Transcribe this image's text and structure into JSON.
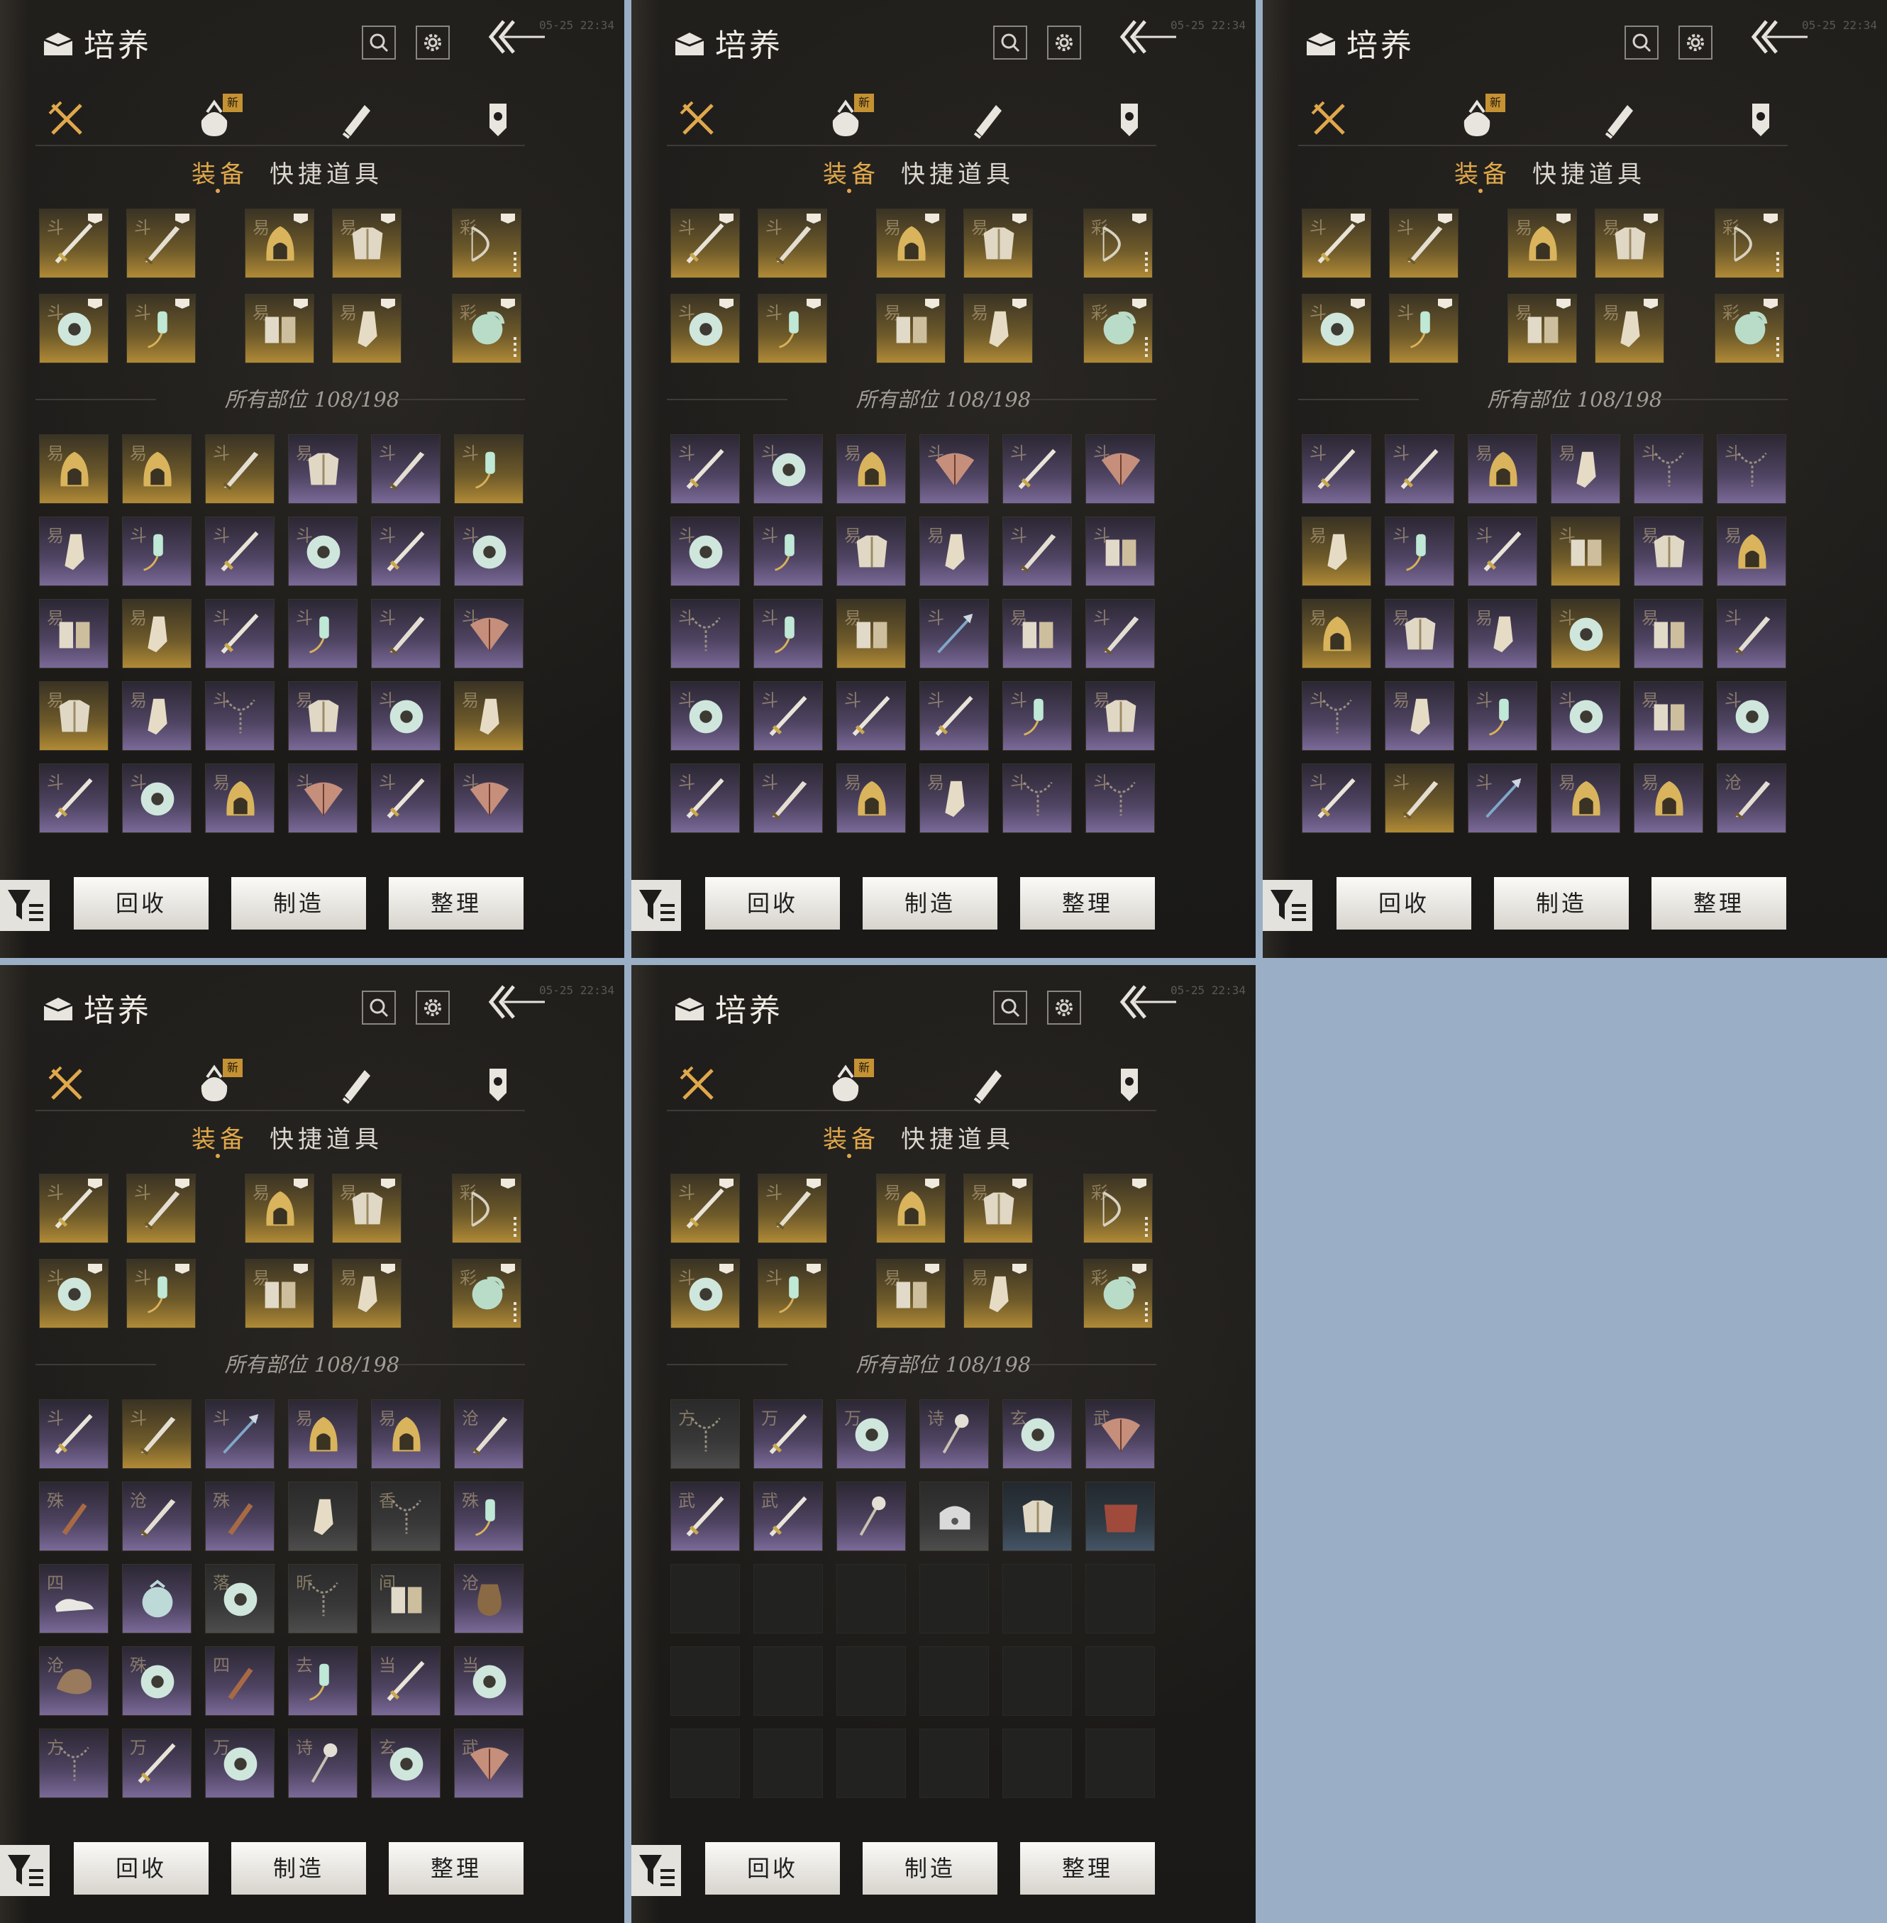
{
  "panel_title": "培养",
  "timestamp": "05-25 22:34",
  "tabs": {
    "equipment": "装备",
    "quick_items": "快捷道具"
  },
  "new_badge": "新",
  "parts_label": "所有部位",
  "parts_count": "108/198",
  "buttons": {
    "recycle": "回收",
    "craft": "制造",
    "sort": "整理"
  },
  "icons": {
    "header": [
      "box-logo-icon",
      "search-icon",
      "gear-icon",
      "back-arrow-icon"
    ],
    "categories": [
      "crossed-swords-icon",
      "pouch-icon",
      "scroll-icon",
      "token-icon"
    ],
    "footer": [
      "filter-icon"
    ]
  },
  "equipped_grid": {
    "row1": [
      {
        "char": "斗",
        "quality": "gold",
        "type": "sword"
      },
      {
        "char": "斗",
        "quality": "gold",
        "type": "blade"
      },
      {
        "char": "易",
        "quality": "gold",
        "type": "hood"
      },
      {
        "char": "易",
        "quality": "gold",
        "type": "armor"
      },
      {
        "char": "彩",
        "quality": "gold",
        "type": "bow"
      }
    ],
    "row2": [
      {
        "char": "斗",
        "quality": "gold",
        "type": "ring"
      },
      {
        "char": "斗",
        "quality": "gold",
        "type": "pendant"
      },
      {
        "char": "易",
        "quality": "gold",
        "type": "bracer"
      },
      {
        "char": "易",
        "quality": "gold",
        "type": "boot"
      },
      {
        "char": "彩",
        "quality": "gold",
        "type": "jade"
      }
    ]
  },
  "panels": [
    {
      "inventory": [
        [
          [
            "易",
            "gold",
            "hood"
          ],
          [
            "易",
            "gold",
            "hood"
          ],
          [
            "斗",
            "gold",
            "blade"
          ],
          [
            "易",
            "purple",
            "armor"
          ],
          [
            "斗",
            "purple",
            "blade"
          ],
          [
            "斗",
            "gold",
            "pendant"
          ]
        ],
        [
          [
            "易",
            "purple",
            "boot"
          ],
          [
            "斗",
            "purple",
            "pendant"
          ],
          [
            "斗",
            "purple",
            "sword"
          ],
          [
            "斗",
            "purple",
            "ring"
          ],
          [
            "斗",
            "purple",
            "sword"
          ],
          [
            "斗",
            "purple",
            "ring"
          ]
        ],
        [
          [
            "易",
            "purple",
            "bracer"
          ],
          [
            "易",
            "gold",
            "boot"
          ],
          [
            "斗",
            "purple",
            "sword"
          ],
          [
            "斗",
            "purple",
            "pendant"
          ],
          [
            "斗",
            "purple",
            "blade"
          ],
          [
            "斗",
            "purple",
            "fan"
          ]
        ],
        [
          [
            "易",
            "gold",
            "armor"
          ],
          [
            "易",
            "purple",
            "boot"
          ],
          [
            "斗",
            "purple",
            "chain"
          ],
          [
            "易",
            "purple",
            "armor"
          ],
          [
            "斗",
            "purple",
            "ring"
          ],
          [
            "易",
            "gold",
            "boot"
          ]
        ],
        [
          [
            "斗",
            "purple",
            "sword"
          ],
          [
            "斗",
            "purple",
            "ring"
          ],
          [
            "易",
            "purple",
            "hood"
          ],
          [
            "斗",
            "purple",
            "fan"
          ],
          [
            "斗",
            "purple",
            "sword"
          ],
          [
            "斗",
            "purple",
            "fan"
          ]
        ]
      ]
    },
    {
      "inventory": [
        [
          [
            "斗",
            "purple",
            "sword"
          ],
          [
            "斗",
            "purple",
            "ring"
          ],
          [
            "易",
            "purple",
            "hood"
          ],
          [
            "斗",
            "purple",
            "fan"
          ],
          [
            "斗",
            "purple",
            "sword"
          ],
          [
            "斗",
            "purple",
            "fan"
          ]
        ],
        [
          [
            "斗",
            "purple",
            "ring"
          ],
          [
            "斗",
            "purple",
            "pendant"
          ],
          [
            "易",
            "purple",
            "armor"
          ],
          [
            "易",
            "purple",
            "boot"
          ],
          [
            "斗",
            "purple",
            "blade"
          ],
          [
            "斗",
            "purple",
            "bracer"
          ]
        ],
        [
          [
            "斗",
            "purple",
            "chain"
          ],
          [
            "斗",
            "purple",
            "pendant"
          ],
          [
            "易",
            "gold",
            "bracer"
          ],
          [
            "斗",
            "purple",
            "spear"
          ],
          [
            "易",
            "purple",
            "bracer"
          ],
          [
            "斗",
            "purple",
            "blade"
          ]
        ],
        [
          [
            "斗",
            "purple",
            "ring"
          ],
          [
            "斗",
            "purple",
            "sword"
          ],
          [
            "斗",
            "purple",
            "sword"
          ],
          [
            "斗",
            "purple",
            "sword"
          ],
          [
            "斗",
            "purple",
            "pendant"
          ],
          [
            "易",
            "purple",
            "armor"
          ]
        ],
        [
          [
            "斗",
            "purple",
            "sword"
          ],
          [
            "斗",
            "purple",
            "blade"
          ],
          [
            "易",
            "purple",
            "hood"
          ],
          [
            "易",
            "purple",
            "boot"
          ],
          [
            "斗",
            "purple",
            "chain"
          ],
          [
            "斗",
            "purple",
            "chain"
          ]
        ]
      ]
    },
    {
      "inventory": [
        [
          [
            "斗",
            "purple",
            "sword"
          ],
          [
            "斗",
            "purple",
            "sword"
          ],
          [
            "易",
            "purple",
            "hood"
          ],
          [
            "易",
            "purple",
            "boot"
          ],
          [
            "斗",
            "purple",
            "chain"
          ],
          [
            "斗",
            "purple",
            "chain"
          ]
        ],
        [
          [
            "易",
            "gold",
            "boot"
          ],
          [
            "斗",
            "purple",
            "pendant"
          ],
          [
            "斗",
            "purple",
            "sword"
          ],
          [
            "斗",
            "gold",
            "bracer"
          ],
          [
            "易",
            "purple",
            "armor"
          ],
          [
            "易",
            "purple",
            "hood"
          ]
        ],
        [
          [
            "易",
            "gold",
            "hood"
          ],
          [
            "易",
            "purple",
            "armor"
          ],
          [
            "易",
            "purple",
            "boot"
          ],
          [
            "斗",
            "gold",
            "ring"
          ],
          [
            "易",
            "purple",
            "bracer"
          ],
          [
            "斗",
            "purple",
            "blade"
          ]
        ],
        [
          [
            "斗",
            "purple",
            "chain"
          ],
          [
            "易",
            "purple",
            "boot"
          ],
          [
            "斗",
            "purple",
            "pendant"
          ],
          [
            "斗",
            "purple",
            "ring"
          ],
          [
            "易",
            "purple",
            "bracer"
          ],
          [
            "斗",
            "purple",
            "ring"
          ]
        ],
        [
          [
            "斗",
            "purple",
            "sword"
          ],
          [
            "斗",
            "gold",
            "blade"
          ],
          [
            "斗",
            "purple",
            "spear"
          ],
          [
            "易",
            "purple",
            "hood"
          ],
          [
            "易",
            "purple",
            "hood"
          ],
          [
            "沧",
            "purple",
            "blade"
          ]
        ]
      ]
    },
    {
      "inventory": [
        [
          [
            "斗",
            "purple",
            "sword"
          ],
          [
            "斗",
            "gold",
            "blade"
          ],
          [
            "斗",
            "purple",
            "spear"
          ],
          [
            "易",
            "purple",
            "hood"
          ],
          [
            "易",
            "purple",
            "hood"
          ],
          [
            "沧",
            "purple",
            "blade"
          ]
        ],
        [
          [
            "殊",
            "purple",
            "dagger"
          ],
          [
            "沧",
            "purple",
            "blade"
          ],
          [
            "殊",
            "purple",
            "dagger"
          ],
          [
            "",
            "gray",
            "boot"
          ],
          [
            "香",
            "gray",
            "chain"
          ],
          [
            "殊",
            "purple",
            "pendant"
          ]
        ],
        [
          [
            "四",
            "purple",
            "shoe"
          ],
          [
            "",
            "purple",
            "pouch"
          ],
          [
            "落",
            "gray",
            "ring"
          ],
          [
            "昕",
            "gray",
            "chain"
          ],
          [
            "间",
            "gray",
            "bracer"
          ],
          [
            "沧",
            "purple",
            "jar"
          ]
        ],
        [
          [
            "沧",
            "purple",
            "beast"
          ],
          [
            "殊",
            "purple",
            "ring"
          ],
          [
            "四",
            "purple",
            "dagger"
          ],
          [
            "去",
            "purple",
            "pendant"
          ],
          [
            "当",
            "purple",
            "sword"
          ],
          [
            "当",
            "purple",
            "ring"
          ]
        ],
        [
          [
            "方",
            "purple",
            "chain"
          ],
          [
            "万",
            "purple",
            "sword"
          ],
          [
            "万",
            "purple",
            "ring"
          ],
          [
            "诗",
            "purple",
            "pin"
          ],
          [
            "玄",
            "purple",
            "ring"
          ],
          [
            "武",
            "purple",
            "fan"
          ]
        ]
      ]
    },
    {
      "inventory": [
        [
          [
            "方",
            "gray",
            "chain"
          ],
          [
            "万",
            "purple",
            "sword"
          ],
          [
            "万",
            "purple",
            "ring"
          ],
          [
            "诗",
            "purple",
            "pin"
          ],
          [
            "玄",
            "purple",
            "ring"
          ],
          [
            "武",
            "purple",
            "fan"
          ]
        ],
        [
          [
            "武",
            "purple",
            "sword"
          ],
          [
            "武",
            "purple",
            "sword"
          ],
          [
            "",
            "purple",
            "pin"
          ],
          [
            "",
            "gray",
            "lock"
          ],
          [
            "",
            "bluegray",
            "armor"
          ],
          [
            "",
            "bluegray",
            "cloth"
          ]
        ],
        [
          [
            "",
            "empty",
            ""
          ],
          [
            "",
            "empty",
            ""
          ],
          [
            "",
            "empty",
            ""
          ],
          [
            "",
            "empty",
            ""
          ],
          [
            "",
            "empty",
            ""
          ],
          [
            "",
            "empty",
            ""
          ]
        ],
        [
          [
            "",
            "empty",
            ""
          ],
          [
            "",
            "empty",
            ""
          ],
          [
            "",
            "empty",
            ""
          ],
          [
            "",
            "empty",
            ""
          ],
          [
            "",
            "empty",
            ""
          ],
          [
            "",
            "empty",
            ""
          ]
        ],
        [
          [
            "",
            "empty",
            ""
          ],
          [
            "",
            "empty",
            ""
          ],
          [
            "",
            "empty",
            ""
          ],
          [
            "",
            "empty",
            ""
          ],
          [
            "",
            "empty",
            ""
          ],
          [
            "",
            "empty",
            ""
          ]
        ]
      ]
    }
  ]
}
